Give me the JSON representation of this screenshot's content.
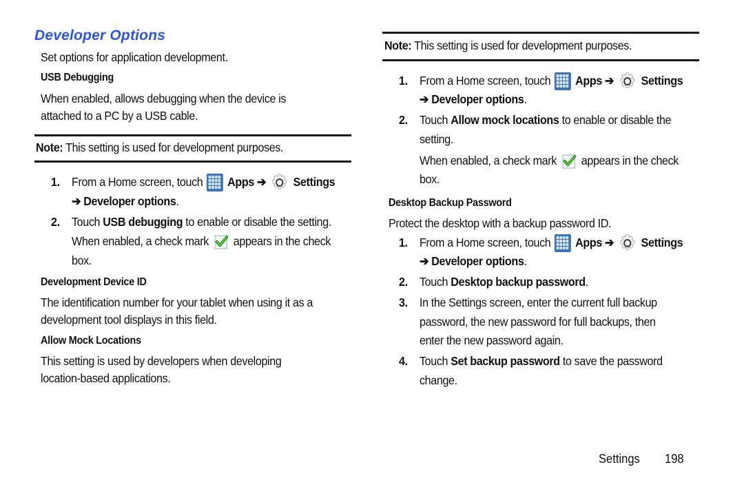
{
  "page": {
    "section_title": "Developer Options",
    "intro": "Set options for application development.",
    "left": {
      "usb_heading": "USB Debugging",
      "usb_desc_line1": "When enabled, allows debugging when the device is",
      "usb_desc_line2": "attached to a PC by a USB cable.",
      "note_label": "Note:",
      "note_text": " This setting is used for development purposes.",
      "steps": [
        {
          "num": "1.",
          "pre": "From a Home screen, touch",
          "apps": "Apps",
          "arrow": "➔",
          "settings": "Settings",
          "line2_arrow": "➔",
          "line2_bold": "Developer options",
          "line2_end": "."
        },
        {
          "num": "2.",
          "pre": "Touch ",
          "bold": "USB debugging",
          "post": " to enable or disable the setting.",
          "line2_pre": "When enabled, a check mark",
          "line2_post": "appears in the check",
          "line3": "box."
        }
      ],
      "device_id_heading": "Development Device ID",
      "device_id_line1": "The identification number for your tablet when using it as a",
      "device_id_line2": "development tool displays in this field.",
      "mock_heading": "Allow Mock Locations",
      "mock_line1": "This setting is used by developers when developing",
      "mock_line2": "location-based applications."
    },
    "right": {
      "note_label": "Note:",
      "note_text": " This setting is used for development purposes.",
      "mock_steps": [
        {
          "num": "1.",
          "pre": "From a Home screen, touch",
          "apps": "Apps",
          "arrow": "➔",
          "settings": "Settings",
          "line2_arrow": "➔",
          "line2_bold": "Developer options",
          "line2_end": "."
        },
        {
          "num": "2.",
          "pre": "Touch ",
          "bold": "Allow mock locations",
          "post": " to enable or disable the",
          "line2": "setting.",
          "line3_pre": "When enabled, a check mark",
          "line3_post": "appears in the check",
          "line4": "box."
        }
      ],
      "backup_heading": "Desktop Backup Password",
      "backup_desc": "Protect the desktop with a backup password ID.",
      "backup_steps": [
        {
          "num": "1.",
          "pre": "From a Home screen, touch",
          "apps": "Apps",
          "arrow": "➔",
          "settings": "Settings",
          "line2_arrow": "➔",
          "line2_bold": "Developer options",
          "line2_end": "."
        },
        {
          "num": "2.",
          "pre": "Touch ",
          "bold": "Desktop backup password",
          "post": "."
        },
        {
          "num": "3.",
          "line1": "In the Settings screen, enter the current full backup",
          "line2": "password, the new password for full backups, then",
          "line3": "enter the new password again."
        },
        {
          "num": "4.",
          "pre": "Touch ",
          "bold": "Set backup password",
          "post": " to save the password",
          "line2": "change."
        }
      ]
    },
    "footer": {
      "section": "Settings",
      "page_number": "198"
    },
    "icons": {
      "apps": "apps-grid-icon",
      "settings": "settings-gear-icon",
      "check": "checkbox-checked-icon"
    },
    "colors": {
      "title": "#2a55e5",
      "apps_icon": "#3c74b8",
      "check": "#3fb62a"
    }
  }
}
